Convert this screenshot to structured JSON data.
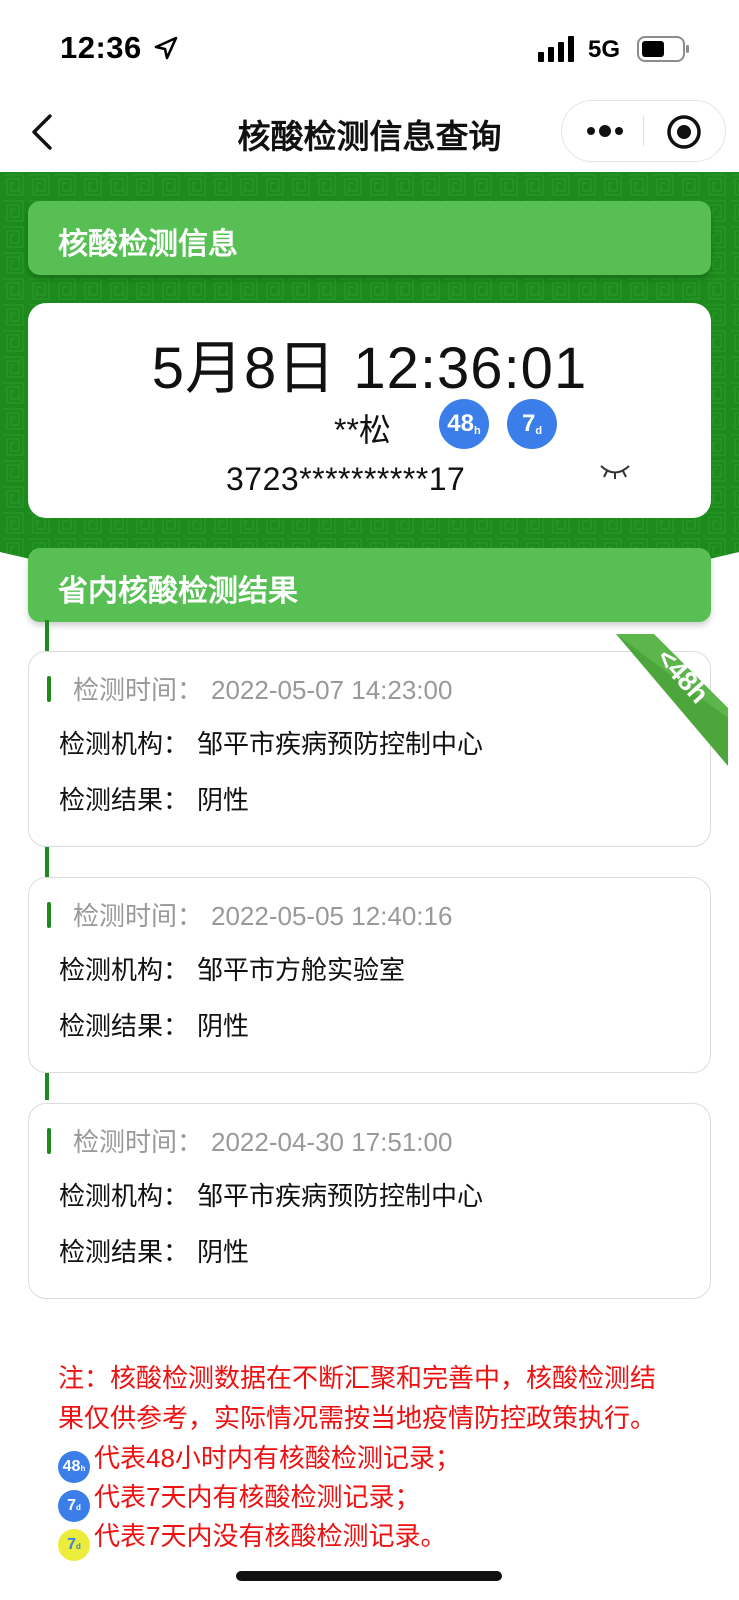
{
  "status_bar": {
    "time": "12:36",
    "network": "5G",
    "icons": [
      "location-arrow-icon",
      "signal-icon",
      "battery-icon"
    ]
  },
  "nav": {
    "title": "核酸检测信息查询",
    "icons": [
      "back-icon",
      "more-icon",
      "target-icon"
    ]
  },
  "info_section": {
    "title": "核酸检测信息",
    "clock": "5月8日 12:36:01",
    "name": "**松",
    "badge_48": {
      "num": "48",
      "unit": "h"
    },
    "badge_7": {
      "num": "7",
      "unit": "d"
    },
    "id_number": "3723**********17",
    "icons": [
      "eye-closed-icon"
    ]
  },
  "results_section": {
    "title": "省内核酸检测结果",
    "ribbon": "<48h",
    "records": [
      {
        "time_label": "检测时间：",
        "time": "2022-05-07 14:23:00",
        "org_label": "检测机构：",
        "org": "邹平市疾病预防控制中心",
        "result_label": "检测结果：",
        "result": "阴性"
      },
      {
        "time_label": "检测时间：",
        "time": "2022-05-05 12:40:16",
        "org_label": "检测机构：",
        "org": "邹平市方舱实验室",
        "result_label": "检测结果：",
        "result": "阴性"
      },
      {
        "time_label": "检测时间：",
        "time": "2022-04-30 17:51:00",
        "org_label": "检测机构：",
        "org": "邹平市疾病预防控制中心",
        "result_label": "检测结果：",
        "result": "阴性"
      }
    ]
  },
  "notes": {
    "line1": "注：核酸检测数据在不断汇聚和完善中，核酸检测结",
    "line2": "果仅供参考，实际情况需按当地疫情防控政策执行。",
    "legend_48": "代表48小时内有核酸检测记录；",
    "legend_7": "代表7天内有核酸检测记录；",
    "legend_7_none": "代表7天内没有核酸检测记录。"
  },
  "colors": {
    "green_dark": "#1c8a1c",
    "green_light": "#57bf54",
    "badge_blue": "#3b7de9",
    "badge_yellow": "#ecec3a",
    "note_red": "#ee1111"
  }
}
